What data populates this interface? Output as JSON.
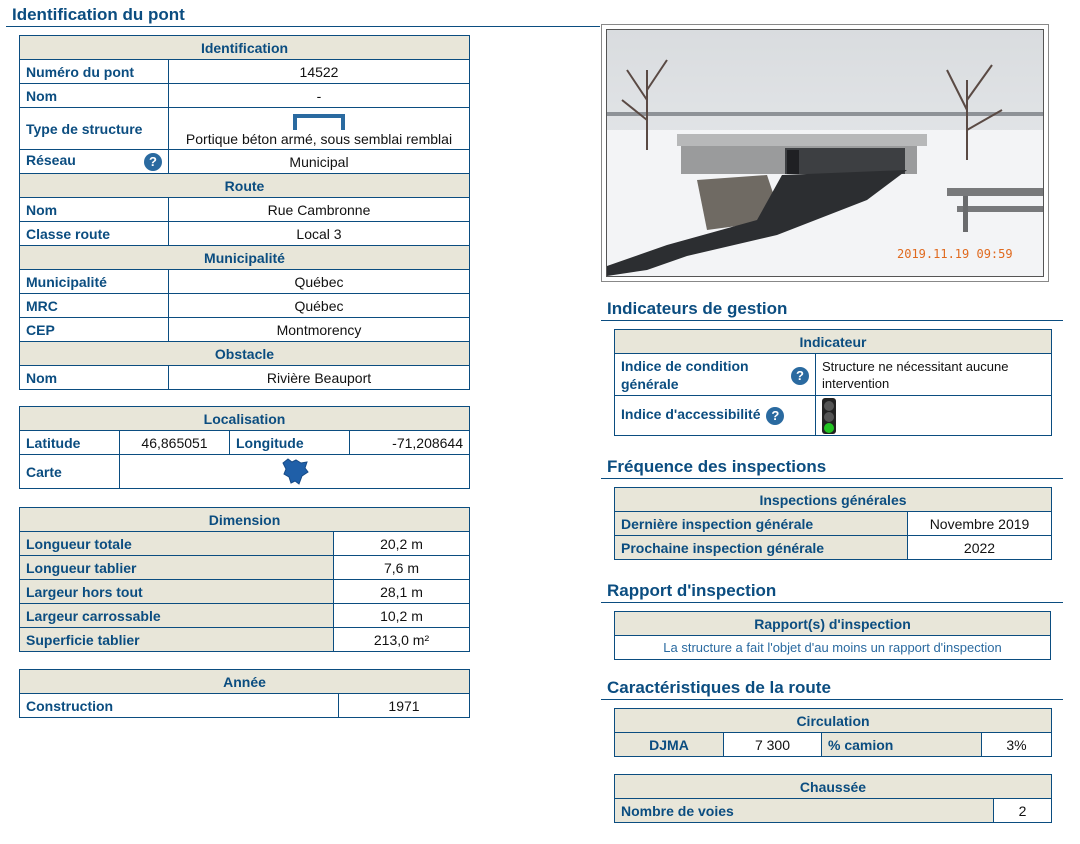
{
  "page": {
    "title": "Identification du pont"
  },
  "identification": {
    "header": "Identification",
    "numero_label": "Numéro du pont",
    "numero_value": "14522",
    "nom_label": "Nom",
    "nom_value": "-",
    "type_label": "Type de structure",
    "type_value": "Portique béton armé, sous semblai remblai",
    "reseau_label": "Réseau",
    "reseau_value": "Municipal",
    "route_header": "Route",
    "route_nom_label": "Nom",
    "route_nom_value": "Rue Cambronne",
    "classe_label": "Classe route",
    "classe_value": "Local 3",
    "muni_header": "Municipalité",
    "muni_label": "Municipalité",
    "muni_value": "Québec",
    "mrc_label": "MRC",
    "mrc_value": "Québec",
    "cep_label": "CEP",
    "cep_value": "Montmorency",
    "obstacle_header": "Obstacle",
    "obstacle_nom_label": "Nom",
    "obstacle_nom_value": "Rivière Beauport"
  },
  "localisation": {
    "header": "Localisation",
    "lat_label": "Latitude",
    "lat_value": "46,865051",
    "lon_label": "Longitude",
    "lon_value": "-71,208644",
    "carte_label": "Carte"
  },
  "dimension": {
    "header": "Dimension",
    "rows": [
      {
        "label": "Longueur totale",
        "value": "20,2 m"
      },
      {
        "label": "Longueur tablier",
        "value": "7,6 m"
      },
      {
        "label": "Largeur hors tout",
        "value": "28,1 m"
      },
      {
        "label": "Largeur carrossable",
        "value": "10,2 m"
      },
      {
        "label": "Superficie tablier",
        "value": "213,0 m²"
      }
    ]
  },
  "annee": {
    "header": "Année",
    "construction_label": "Construction",
    "construction_value": "1971"
  },
  "photo": {
    "timestamp": "2019.11.19  09:59"
  },
  "indicateurs": {
    "title": "Indicateurs de gestion",
    "header": "Indicateur",
    "condition_label": "Indice de condition générale",
    "condition_value": "Structure ne nécessitant aucune intervention",
    "access_label": "Indice d'accessibilité",
    "access_light": "green"
  },
  "frequence": {
    "title": "Fréquence des inspections",
    "header": "Inspections générales",
    "derniere_label": "Dernière inspection générale",
    "derniere_value": "Novembre 2019",
    "prochaine_label": "Prochaine inspection générale",
    "prochaine_value": "2022"
  },
  "rapport": {
    "title": "Rapport d'inspection",
    "header": "Rapport(s) d'inspection",
    "text": "La structure a fait l'objet d'au moins un rapport d'inspection"
  },
  "route_carac": {
    "title": "Caractéristiques de la route",
    "circ_header": "Circulation",
    "djma_label": "DJMA",
    "djma_value": "7 300",
    "camion_label": "% camion",
    "camion_value": "3%",
    "chaussee_header": "Chaussée",
    "voies_label": "Nombre de voies",
    "voies_value": "2"
  },
  "icons": {
    "help": "?"
  }
}
